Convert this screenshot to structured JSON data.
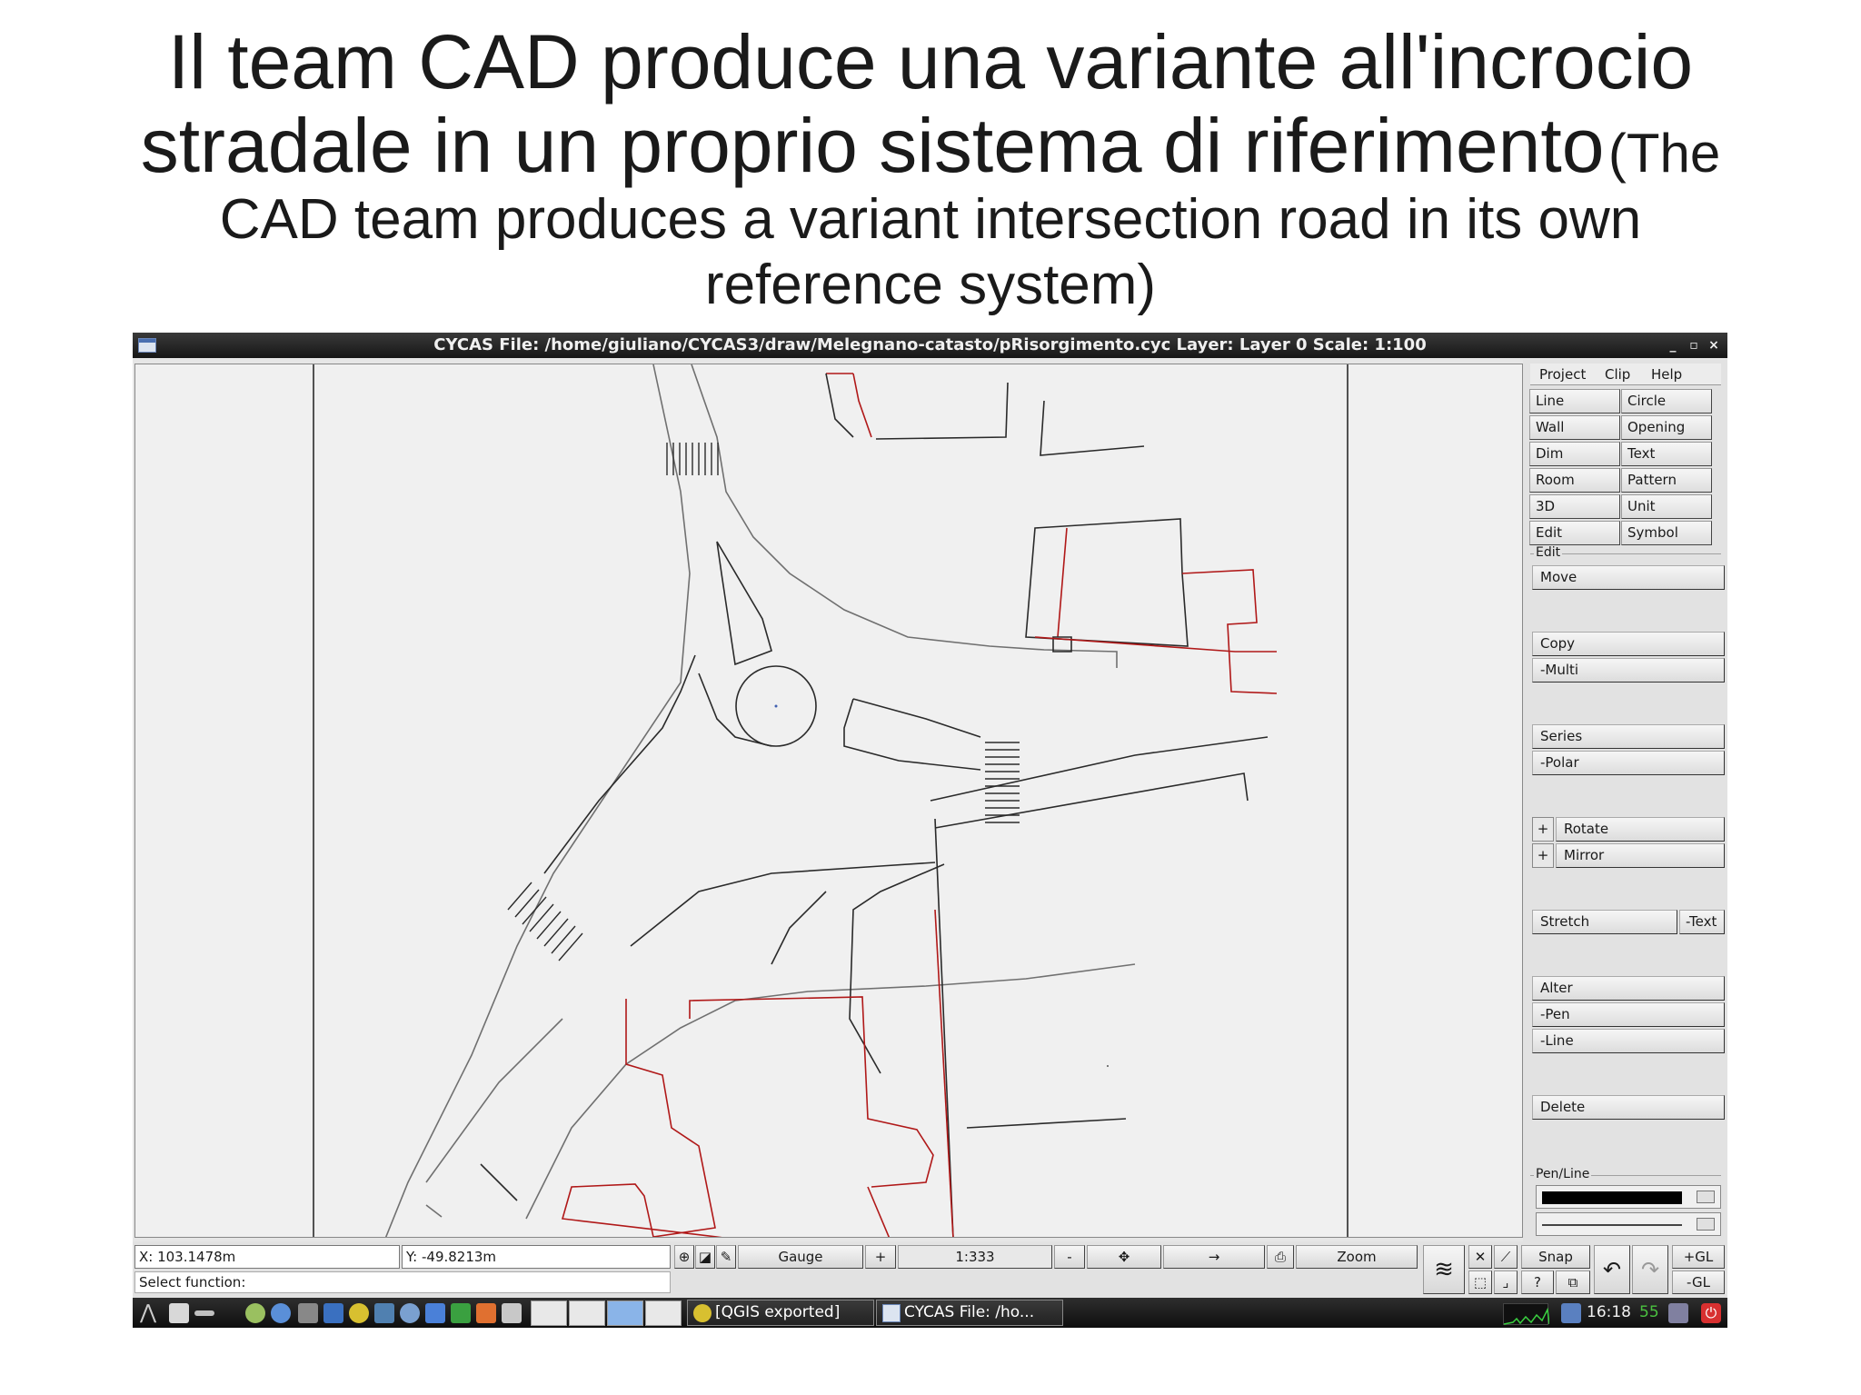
{
  "slide": {
    "title_line1": "Il team CAD produce una variante all'incrocio",
    "title_line2": "stradale in un proprio sistema di riferimento",
    "title_en_start": "(The",
    "title_en_line3": "CAD team produces a variant intersection road in its own",
    "title_en_line4": "reference system)"
  },
  "window": {
    "title": "CYCAS  File: /home/giuliano/CYCAS3/draw/Melegnano-catasto/pRisorgimento.cyc  Layer: Layer 0  Scale: 1:100",
    "controls": [
      "_",
      "▫",
      "×"
    ]
  },
  "menu": {
    "items": [
      "Project",
      "Clip",
      "Help"
    ]
  },
  "tools": [
    "Line",
    "Circle",
    "Wall",
    "Opening",
    "Dim",
    "Text",
    "Room",
    "Pattern",
    "3D",
    "Unit",
    "Edit",
    "Symbol"
  ],
  "edit_panel": {
    "group_label": "Edit",
    "move": "Move",
    "copy": "Copy",
    "multi": "-Multi",
    "series": "Series",
    "polar": "-Polar",
    "plus": "+",
    "rotate": "Rotate",
    "mirror": "Mirror",
    "stretch": "Stretch",
    "stretch_text": "-Text",
    "alter": "Alter",
    "pen": "-Pen",
    "line": "-Line",
    "delete": "Delete",
    "pen_line_label": "Pen/Line"
  },
  "status": {
    "x": "X: 103.1478m",
    "y": "Y: -49.8213m",
    "gauge": "Gauge",
    "plus": "+",
    "scale": "1:333",
    "minus": "-",
    "zoom": "Zoom",
    "snap": "Snap",
    "gl_plus": "+GL",
    "gl_minus": "-GL",
    "question": "?",
    "select_function": "Select function:"
  },
  "taskbar": {
    "task1": "[QGIS exported]",
    "task2": "CYCAS  File: /ho...",
    "clock": "16:18",
    "clock_extra": "55"
  },
  "colors": {
    "drawing_line": "#2a2a2a",
    "red_line": "#b01818",
    "gray_line": "#707070",
    "canvas_bg": "#f0f0f0"
  }
}
